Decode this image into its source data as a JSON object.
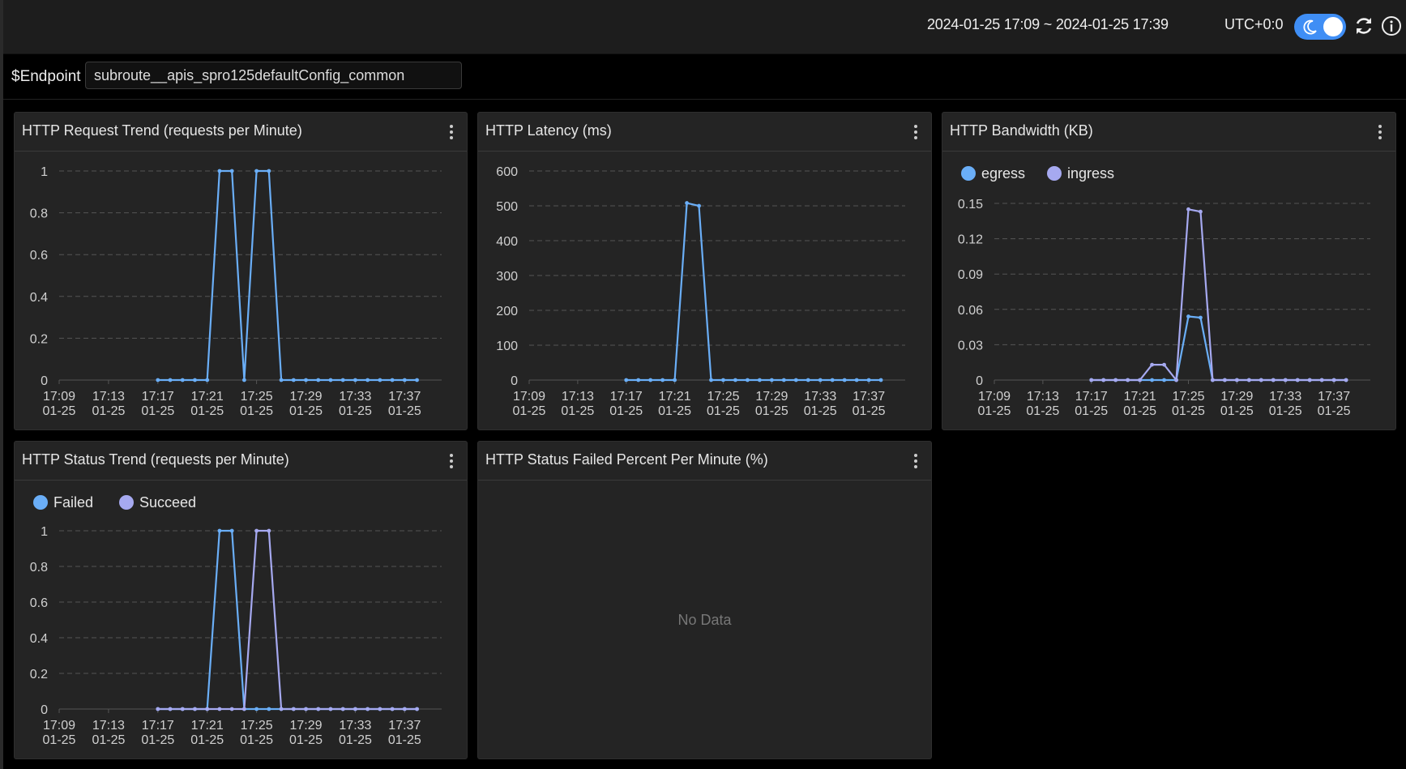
{
  "topbar": {
    "time_range": "2024-01-25 17:09 ~ 2024-01-25 17:39",
    "timezone": "UTC+0:0",
    "theme_toggle_icon": "moon-icon",
    "refresh_icon": "refresh-icon",
    "info_icon": "info-icon"
  },
  "variables": {
    "label": "$Endpoint",
    "value": "subroute__apis_spro125defaultConfig_common"
  },
  "colors": {
    "series1": "#6aaef7",
    "series2": "#a6a9f0",
    "grid": "#555555",
    "panel_bg": "#242424"
  },
  "panels": [
    {
      "title": "HTTP Request Trend (requests per Minute)"
    },
    {
      "title": "HTTP Latency (ms)"
    },
    {
      "title": "HTTP Bandwidth (KB)"
    },
    {
      "title": "HTTP Status Trend (requests per Minute)"
    },
    {
      "title": "HTTP Status Failed Percent Per Minute (%)",
      "empty_text": "No Data"
    }
  ],
  "chart_data": [
    {
      "type": "line",
      "title": "HTTP Request Trend (requests per Minute)",
      "x_ticks": [
        "17:09\n01-25",
        "17:13\n01-25",
        "17:17\n01-25",
        "17:21\n01-25",
        "17:25\n01-25",
        "17:29\n01-25",
        "17:33\n01-25",
        "17:37\n01-25"
      ],
      "x_range": [
        "17:09",
        "17:40"
      ],
      "x": [
        "17:17",
        "17:18",
        "17:19",
        "17:20",
        "17:21",
        "17:22",
        "17:23",
        "17:24",
        "17:25",
        "17:26",
        "17:27",
        "17:28",
        "17:29",
        "17:30",
        "17:31",
        "17:32",
        "17:33",
        "17:34",
        "17:35",
        "17:36",
        "17:37",
        "17:38"
      ],
      "series": [
        {
          "values": [
            0,
            0,
            0,
            0,
            0,
            1,
            1,
            0,
            1,
            1,
            0,
            0,
            0,
            0,
            0,
            0,
            0,
            0,
            0,
            0,
            0,
            0
          ]
        }
      ],
      "ylim": [
        0,
        1
      ],
      "y_ticks": [
        0,
        0.2,
        0.4,
        0.6,
        0.8,
        1
      ],
      "grid": true
    },
    {
      "type": "line",
      "title": "HTTP Latency (ms)",
      "x_ticks": [
        "17:09\n01-25",
        "17:13\n01-25",
        "17:17\n01-25",
        "17:21\n01-25",
        "17:25\n01-25",
        "17:29\n01-25",
        "17:33\n01-25",
        "17:37\n01-25"
      ],
      "x_range": [
        "17:09",
        "17:40"
      ],
      "x": [
        "17:17",
        "17:18",
        "17:19",
        "17:20",
        "17:21",
        "17:22",
        "17:23",
        "17:24",
        "17:25",
        "17:26",
        "17:27",
        "17:28",
        "17:29",
        "17:30",
        "17:31",
        "17:32",
        "17:33",
        "17:34",
        "17:35",
        "17:36",
        "17:37",
        "17:38"
      ],
      "series": [
        {
          "values": [
            0,
            0,
            0,
            0,
            0,
            508,
            500,
            0,
            0,
            0,
            0,
            0,
            0,
            0,
            0,
            0,
            0,
            0,
            0,
            0,
            0,
            0
          ]
        }
      ],
      "ylim": [
        0,
        600
      ],
      "y_ticks": [
        0,
        100,
        200,
        300,
        400,
        500,
        600
      ],
      "grid": true
    },
    {
      "type": "line",
      "title": "HTTP Bandwidth (KB)",
      "legend": [
        "egress",
        "ingress"
      ],
      "legend_placement": "top-left",
      "x_ticks": [
        "17:09\n01-25",
        "17:13\n01-25",
        "17:17\n01-25",
        "17:21\n01-25",
        "17:25\n01-25",
        "17:29\n01-25",
        "17:33\n01-25",
        "17:37\n01-25"
      ],
      "x_range": [
        "17:09",
        "17:40"
      ],
      "x": [
        "17:17",
        "17:18",
        "17:19",
        "17:20",
        "17:21",
        "17:22",
        "17:23",
        "17:24",
        "17:25",
        "17:26",
        "17:27",
        "17:28",
        "17:29",
        "17:30",
        "17:31",
        "17:32",
        "17:33",
        "17:34",
        "17:35",
        "17:36",
        "17:37",
        "17:38"
      ],
      "series": [
        {
          "name": "egress",
          "values": [
            0,
            0,
            0,
            0,
            0,
            0,
            0,
            0,
            0.054,
            0.053,
            0,
            0,
            0,
            0,
            0,
            0,
            0,
            0,
            0,
            0,
            0,
            0
          ]
        },
        {
          "name": "ingress",
          "values": [
            0,
            0,
            0,
            0,
            0,
            0.013,
            0.013,
            0,
            0.145,
            0.143,
            0,
            0,
            0,
            0,
            0,
            0,
            0,
            0,
            0,
            0,
            0,
            0
          ]
        }
      ],
      "ylim": [
        0,
        0.15
      ],
      "y_ticks": [
        0,
        0.03,
        0.06,
        0.09,
        0.12,
        0.15
      ],
      "grid": true
    },
    {
      "type": "line",
      "title": "HTTP Status Trend (requests per Minute)",
      "legend": [
        "Failed",
        "Succeed"
      ],
      "legend_placement": "top-left",
      "x_ticks": [
        "17:09\n01-25",
        "17:13\n01-25",
        "17:17\n01-25",
        "17:21\n01-25",
        "17:25\n01-25",
        "17:29\n01-25",
        "17:33\n01-25",
        "17:37\n01-25"
      ],
      "x_range": [
        "17:09",
        "17:40"
      ],
      "x": [
        "17:17",
        "17:18",
        "17:19",
        "17:20",
        "17:21",
        "17:22",
        "17:23",
        "17:24",
        "17:25",
        "17:26",
        "17:27",
        "17:28",
        "17:29",
        "17:30",
        "17:31",
        "17:32",
        "17:33",
        "17:34",
        "17:35",
        "17:36",
        "17:37",
        "17:38"
      ],
      "series": [
        {
          "name": "Failed",
          "values": [
            0,
            0,
            0,
            0,
            0,
            1,
            1,
            0,
            0,
            0,
            0,
            0,
            0,
            0,
            0,
            0,
            0,
            0,
            0,
            0,
            0,
            0
          ]
        },
        {
          "name": "Succeed",
          "values": [
            0,
            0,
            0,
            0,
            0,
            0,
            0,
            0,
            1,
            1,
            0,
            0,
            0,
            0,
            0,
            0,
            0,
            0,
            0,
            0,
            0,
            0
          ]
        }
      ],
      "ylim": [
        0,
        1
      ],
      "y_ticks": [
        0,
        0.2,
        0.4,
        0.6,
        0.8,
        1
      ],
      "grid": true
    },
    {
      "type": "line",
      "title": "HTTP Status Failed Percent Per Minute (%)",
      "series": []
    }
  ]
}
